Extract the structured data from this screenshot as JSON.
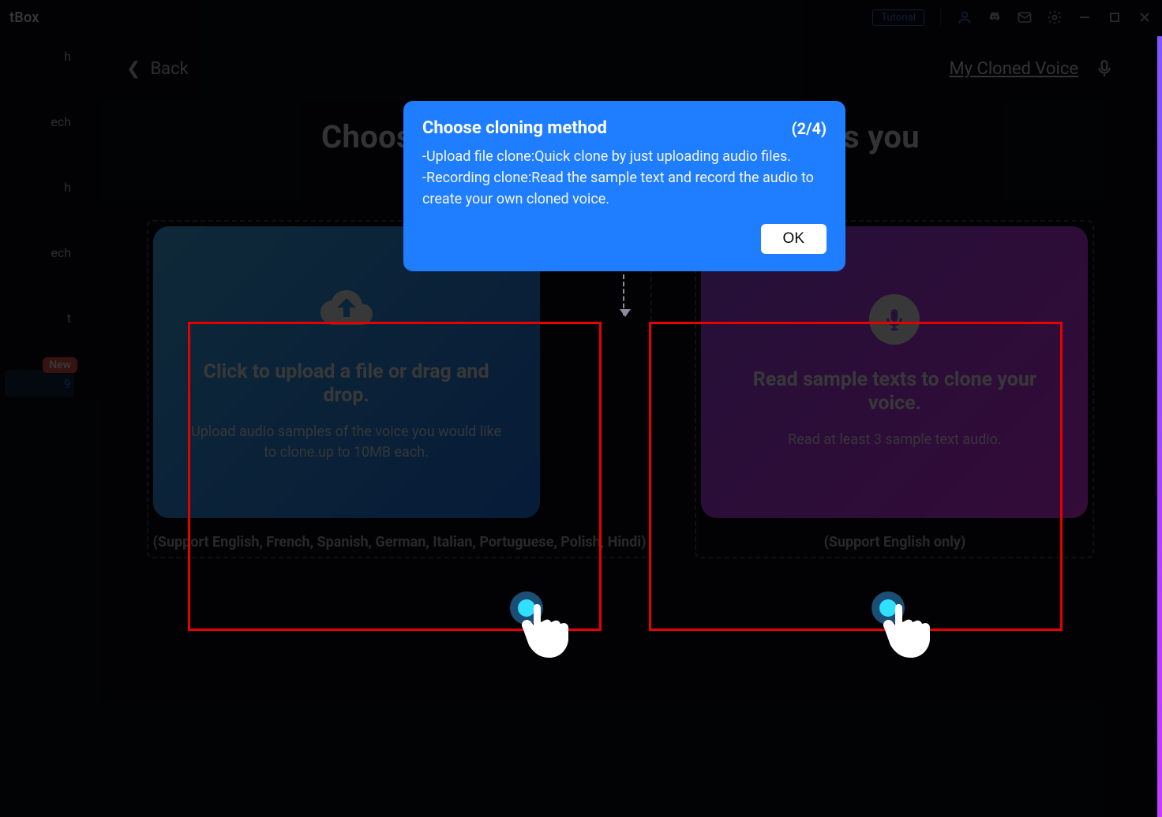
{
  "titlebar": {
    "app_name_suffix": "tBox",
    "tutorial_label": "Tutorial"
  },
  "sidebar": {
    "items": [
      {
        "label": "h"
      },
      {
        "label": "ech"
      },
      {
        "label": "h"
      },
      {
        "label": "ech"
      },
      {
        "label": "t"
      },
      {
        "label": "9",
        "active": true,
        "badge": "New"
      }
    ]
  },
  "subheader": {
    "back_label": "Back",
    "my_cloned_voice": "My Cloned Voice"
  },
  "page_title": "Choose the cloning method that suits you",
  "cards": {
    "upload": {
      "title": "Click to upload a file or drag and drop.",
      "sub": "Upload audio samples of the voice you would like to clone.up to 10MB each.",
      "support": "(Support English, French, Spanish, German, Italian, Portuguese, Polish, Hindi)"
    },
    "record": {
      "title": "Read sample texts to clone your voice.",
      "sub": "Read at least 3 sample text audio.",
      "support": "(Support English only)"
    }
  },
  "popover": {
    "title": "Choose cloning method",
    "step": "(2/4)",
    "body_line1": "-Upload file clone:Quick clone by just uploading audio files.",
    "body_line2": "-Recording clone:Read the sample text and record the audio to create your own cloned voice.",
    "ok_label": "OK"
  }
}
